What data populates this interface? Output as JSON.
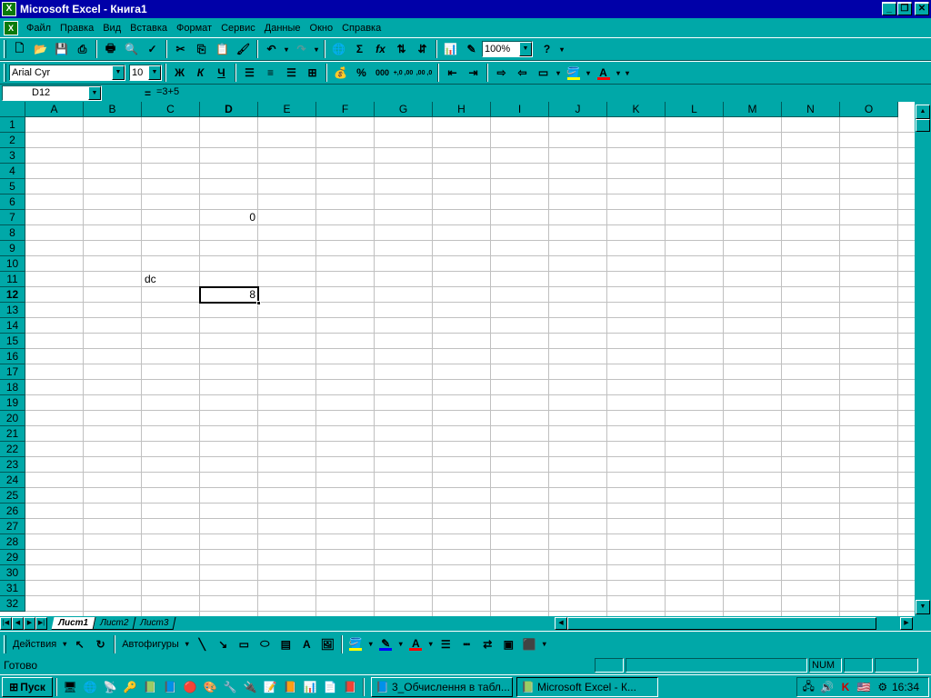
{
  "window": {
    "title": "Microsoft Excel - Книга1",
    "app_icon": "excel-icon"
  },
  "menu": {
    "items": [
      "Файл",
      "Правка",
      "Вид",
      "Вставка",
      "Формат",
      "Сервис",
      "Данные",
      "Окно",
      "Справка"
    ]
  },
  "toolbar": {
    "zoom": "100%",
    "font_name": "Arial Cyr",
    "font_size": "10",
    "bold_label": "Ж",
    "italic_label": "К",
    "underline_label": "Ч",
    "sigma_label": "Σ",
    "fx_label": "fx",
    "percent_label": "%",
    "thousands_label": "000",
    "inc_decimal_label": "+,0 ,00",
    "dec_decimal_label": ",00 ,0",
    "help_label": "?"
  },
  "formula_bar": {
    "name_box": "D12",
    "equals": "=",
    "formula": "=3+5"
  },
  "grid": {
    "columns": [
      "A",
      "B",
      "C",
      "D",
      "E",
      "F",
      "G",
      "H",
      "I",
      "J",
      "K",
      "L",
      "M",
      "N",
      "O"
    ],
    "row_count": 32,
    "active_column": "D",
    "active_row": "12",
    "cells": [
      {
        "ref": "D7",
        "value": "0",
        "align": "right"
      },
      {
        "ref": "C11",
        "value": "dc",
        "align": "left"
      },
      {
        "ref": "D12",
        "value": "8",
        "align": "right"
      }
    ]
  },
  "sheets": {
    "tabs": [
      "Лист1",
      "Лист2",
      "Лист3"
    ],
    "active": "Лист1"
  },
  "drawing_bar": {
    "actions_label": "Действия",
    "autoshapes_label": "Автофигуры"
  },
  "status_bar": {
    "text": "Готово",
    "num_indicator": "NUM"
  },
  "taskbar": {
    "start_label": "Пуск",
    "tasks": [
      {
        "label": "3_Обчислення в табл...",
        "active": false
      },
      {
        "label": "Microsoft Excel - К...",
        "active": true
      }
    ],
    "clock": "16:34"
  },
  "colors": {
    "desktop": "#00a8a8",
    "titlebar": "#0000a8",
    "fill_color_swatch": "#ffff00",
    "font_color_swatch": "#ff0000"
  }
}
